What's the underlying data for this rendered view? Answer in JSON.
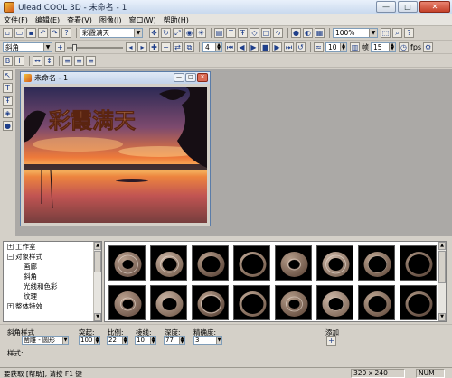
{
  "window": {
    "title": "Ulead COOL 3D - 未命名 - 1",
    "minimize_glyph": "—",
    "maximize_glyph": "□",
    "close_glyph": "✕"
  },
  "menu": [
    "文件(F)",
    "编辑(E)",
    "查看(V)",
    "图像(I)",
    "窗口(W)",
    "帮助(H)"
  ],
  "toolbar1": {
    "style_combo": "彩霞满天",
    "zoom_combo": "100%"
  },
  "toolbar2": {
    "bevel_combo": "斜角",
    "frame_value": "4",
    "time_value": "10",
    "frames_label": "帧",
    "total_frames": "15",
    "fps_label": "fps"
  },
  "document": {
    "title": "未命名 - 1",
    "title_text_art": "彩霞满天"
  },
  "tree": {
    "items": [
      {
        "label": "工作室",
        "exp": "+",
        "indent": 0
      },
      {
        "label": "对象样式",
        "exp": "−",
        "indent": 0
      },
      {
        "label": "画廊",
        "exp": "",
        "indent": 1
      },
      {
        "label": "斜角",
        "exp": "",
        "indent": 1
      },
      {
        "label": "光线和色彩",
        "exp": "",
        "indent": 1
      },
      {
        "label": "纹理",
        "exp": "",
        "indent": 1
      },
      {
        "label": "整体特效",
        "exp": "+",
        "indent": 0
      }
    ]
  },
  "props": {
    "bevel_style_label": "斜角样式",
    "bevel_style_value": "凿雕 - 圆形",
    "protrude_label": "突起:",
    "protrude_value": "100",
    "scale_label": "比例:",
    "scale_value": "22",
    "edge_label": "棱线:",
    "edge_value": "10",
    "depth_label": "深度:",
    "depth_value": "77",
    "precision_label": "精确度:",
    "precision_value": "3",
    "add_label": "添加",
    "style_label": "样式:"
  },
  "status": {
    "help_text": "要获取 [帮助], 请按 F1 键",
    "dimensions": "320 x 240",
    "num": "NUM"
  },
  "colors": {
    "workspace": "#aba9a6",
    "accent": "#5a7ca8"
  }
}
